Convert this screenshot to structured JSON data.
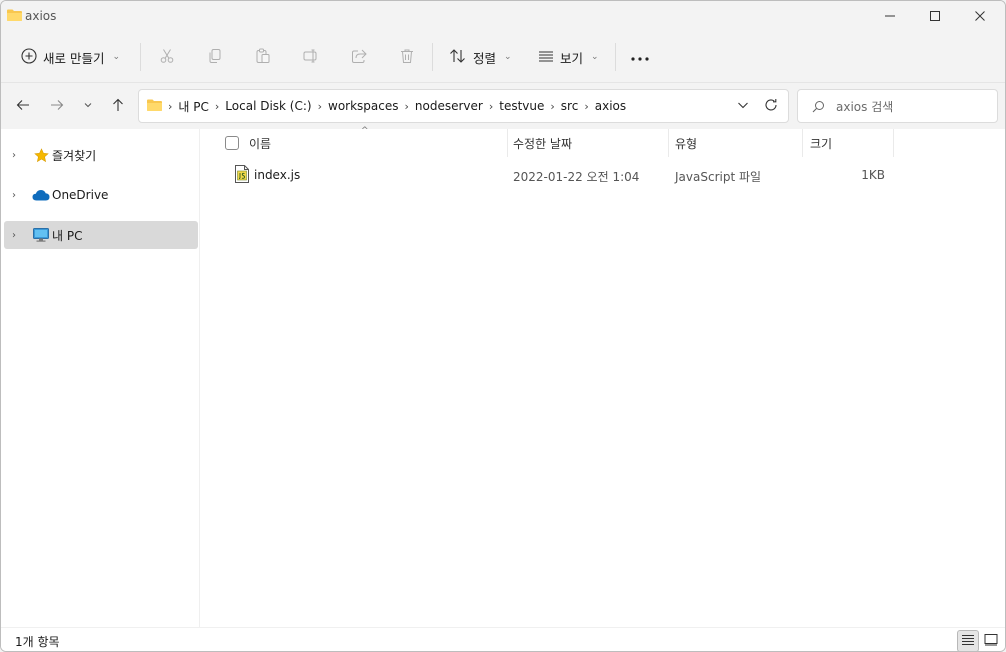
{
  "window": {
    "title": "axios"
  },
  "toolbar": {
    "new_label": "새로 만들기",
    "sort_label": "정렬",
    "view_label": "보기",
    "more_icon": "more-icon"
  },
  "address": {
    "crumbs": [
      "내 PC",
      "Local Disk (C:)",
      "workspaces",
      "nodeserver",
      "testvue",
      "src",
      "axios"
    ]
  },
  "search": {
    "placeholder": "axios 검색"
  },
  "sidebar": {
    "items": [
      {
        "label": "즐겨찾기",
        "icon": "star-icon"
      },
      {
        "label": "OneDrive",
        "icon": "cloud-icon"
      },
      {
        "label": "내 PC",
        "icon": "computer-icon",
        "selected": true
      }
    ]
  },
  "list": {
    "columns": {
      "name": "이름",
      "modified": "수정한 날짜",
      "type": "유형",
      "size": "크기"
    },
    "rows": [
      {
        "name": "index.js",
        "modified": "2022-01-22 오전 1:04",
        "type": "JavaScript 파일",
        "size": "1KB"
      }
    ]
  },
  "status": {
    "count": "1개 항목"
  },
  "colors": {
    "folder": "#f8c74f",
    "star": "#f5b800",
    "onedrive": "#0f6cbd",
    "selected_bg": "#d9d9d9"
  }
}
